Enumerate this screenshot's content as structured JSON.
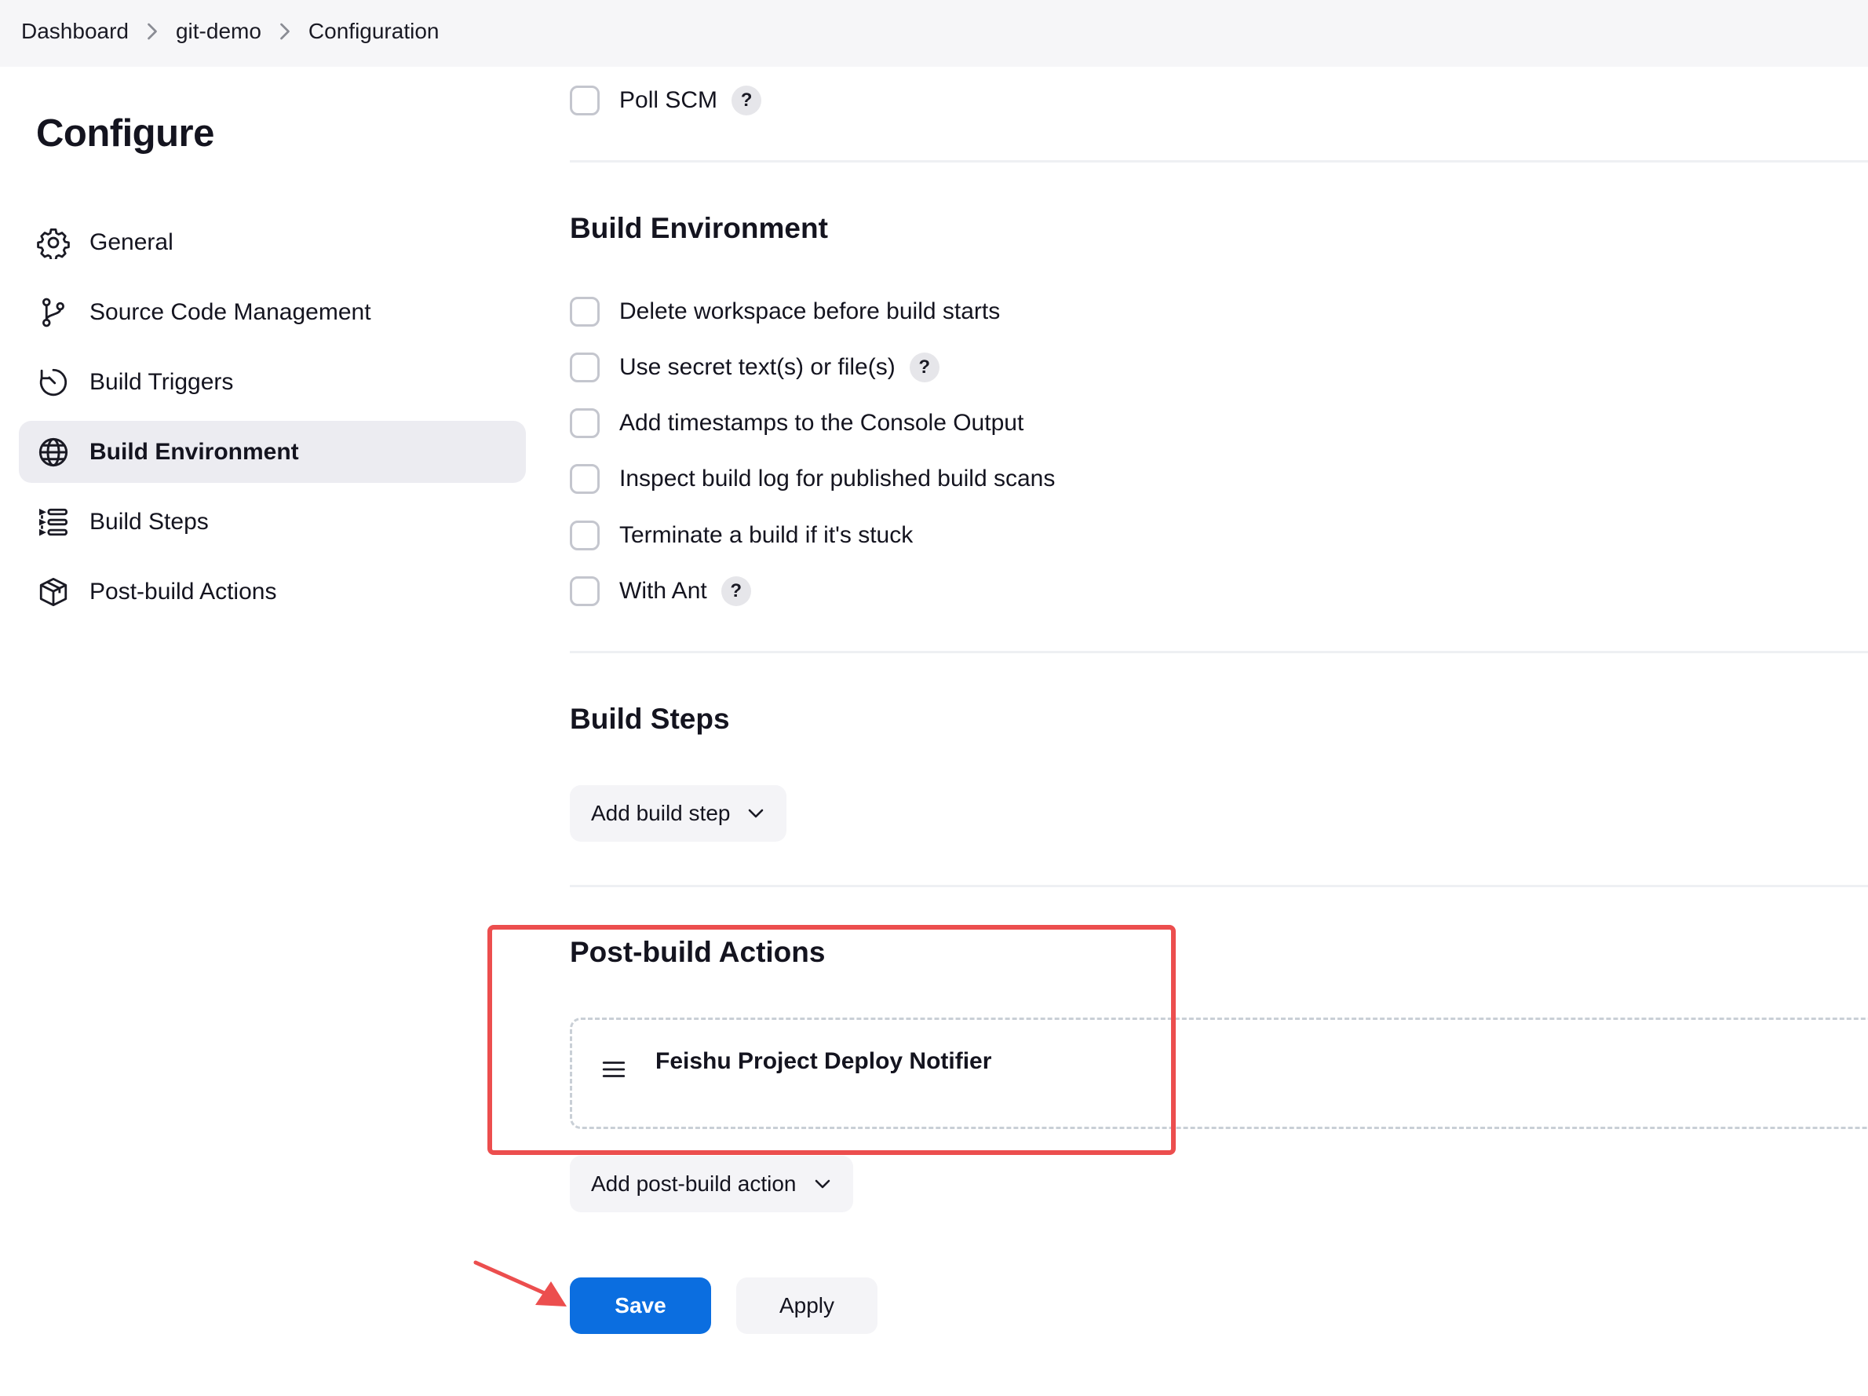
{
  "breadcrumb": {
    "items": [
      "Dashboard",
      "git-demo",
      "Configuration"
    ]
  },
  "sidebar": {
    "title": "Configure",
    "items": [
      {
        "label": "General",
        "icon": "gear-icon",
        "active": false
      },
      {
        "label": "Source Code Management",
        "icon": "branch-icon",
        "active": false
      },
      {
        "label": "Build Triggers",
        "icon": "clock-icon",
        "active": false
      },
      {
        "label": "Build Environment",
        "icon": "globe-icon",
        "active": true
      },
      {
        "label": "Build Steps",
        "icon": "list-icon",
        "active": false
      },
      {
        "label": "Post-build Actions",
        "icon": "package-icon",
        "active": false
      }
    ]
  },
  "triggers": {
    "poll_scm": "Poll SCM"
  },
  "build_environment": {
    "title": "Build Environment",
    "options": [
      "Delete workspace before build starts",
      "Use secret text(s) or file(s)",
      "Add timestamps to the Console Output",
      "Inspect build log for published build scans",
      "Terminate a build if it's stuck",
      "With Ant"
    ]
  },
  "build_steps": {
    "title": "Build Steps",
    "add_label": "Add build step"
  },
  "post_build": {
    "title": "Post-build Actions",
    "notifier_title": "Feishu Project Deploy Notifier",
    "add_label": "Add post-build action"
  },
  "help_glyph": "?",
  "actions": {
    "save": "Save",
    "apply": "Apply"
  },
  "colors": {
    "primary": "#0b6ee0",
    "annotation": "#ec4e4e",
    "active_nav": "#ececf1"
  }
}
